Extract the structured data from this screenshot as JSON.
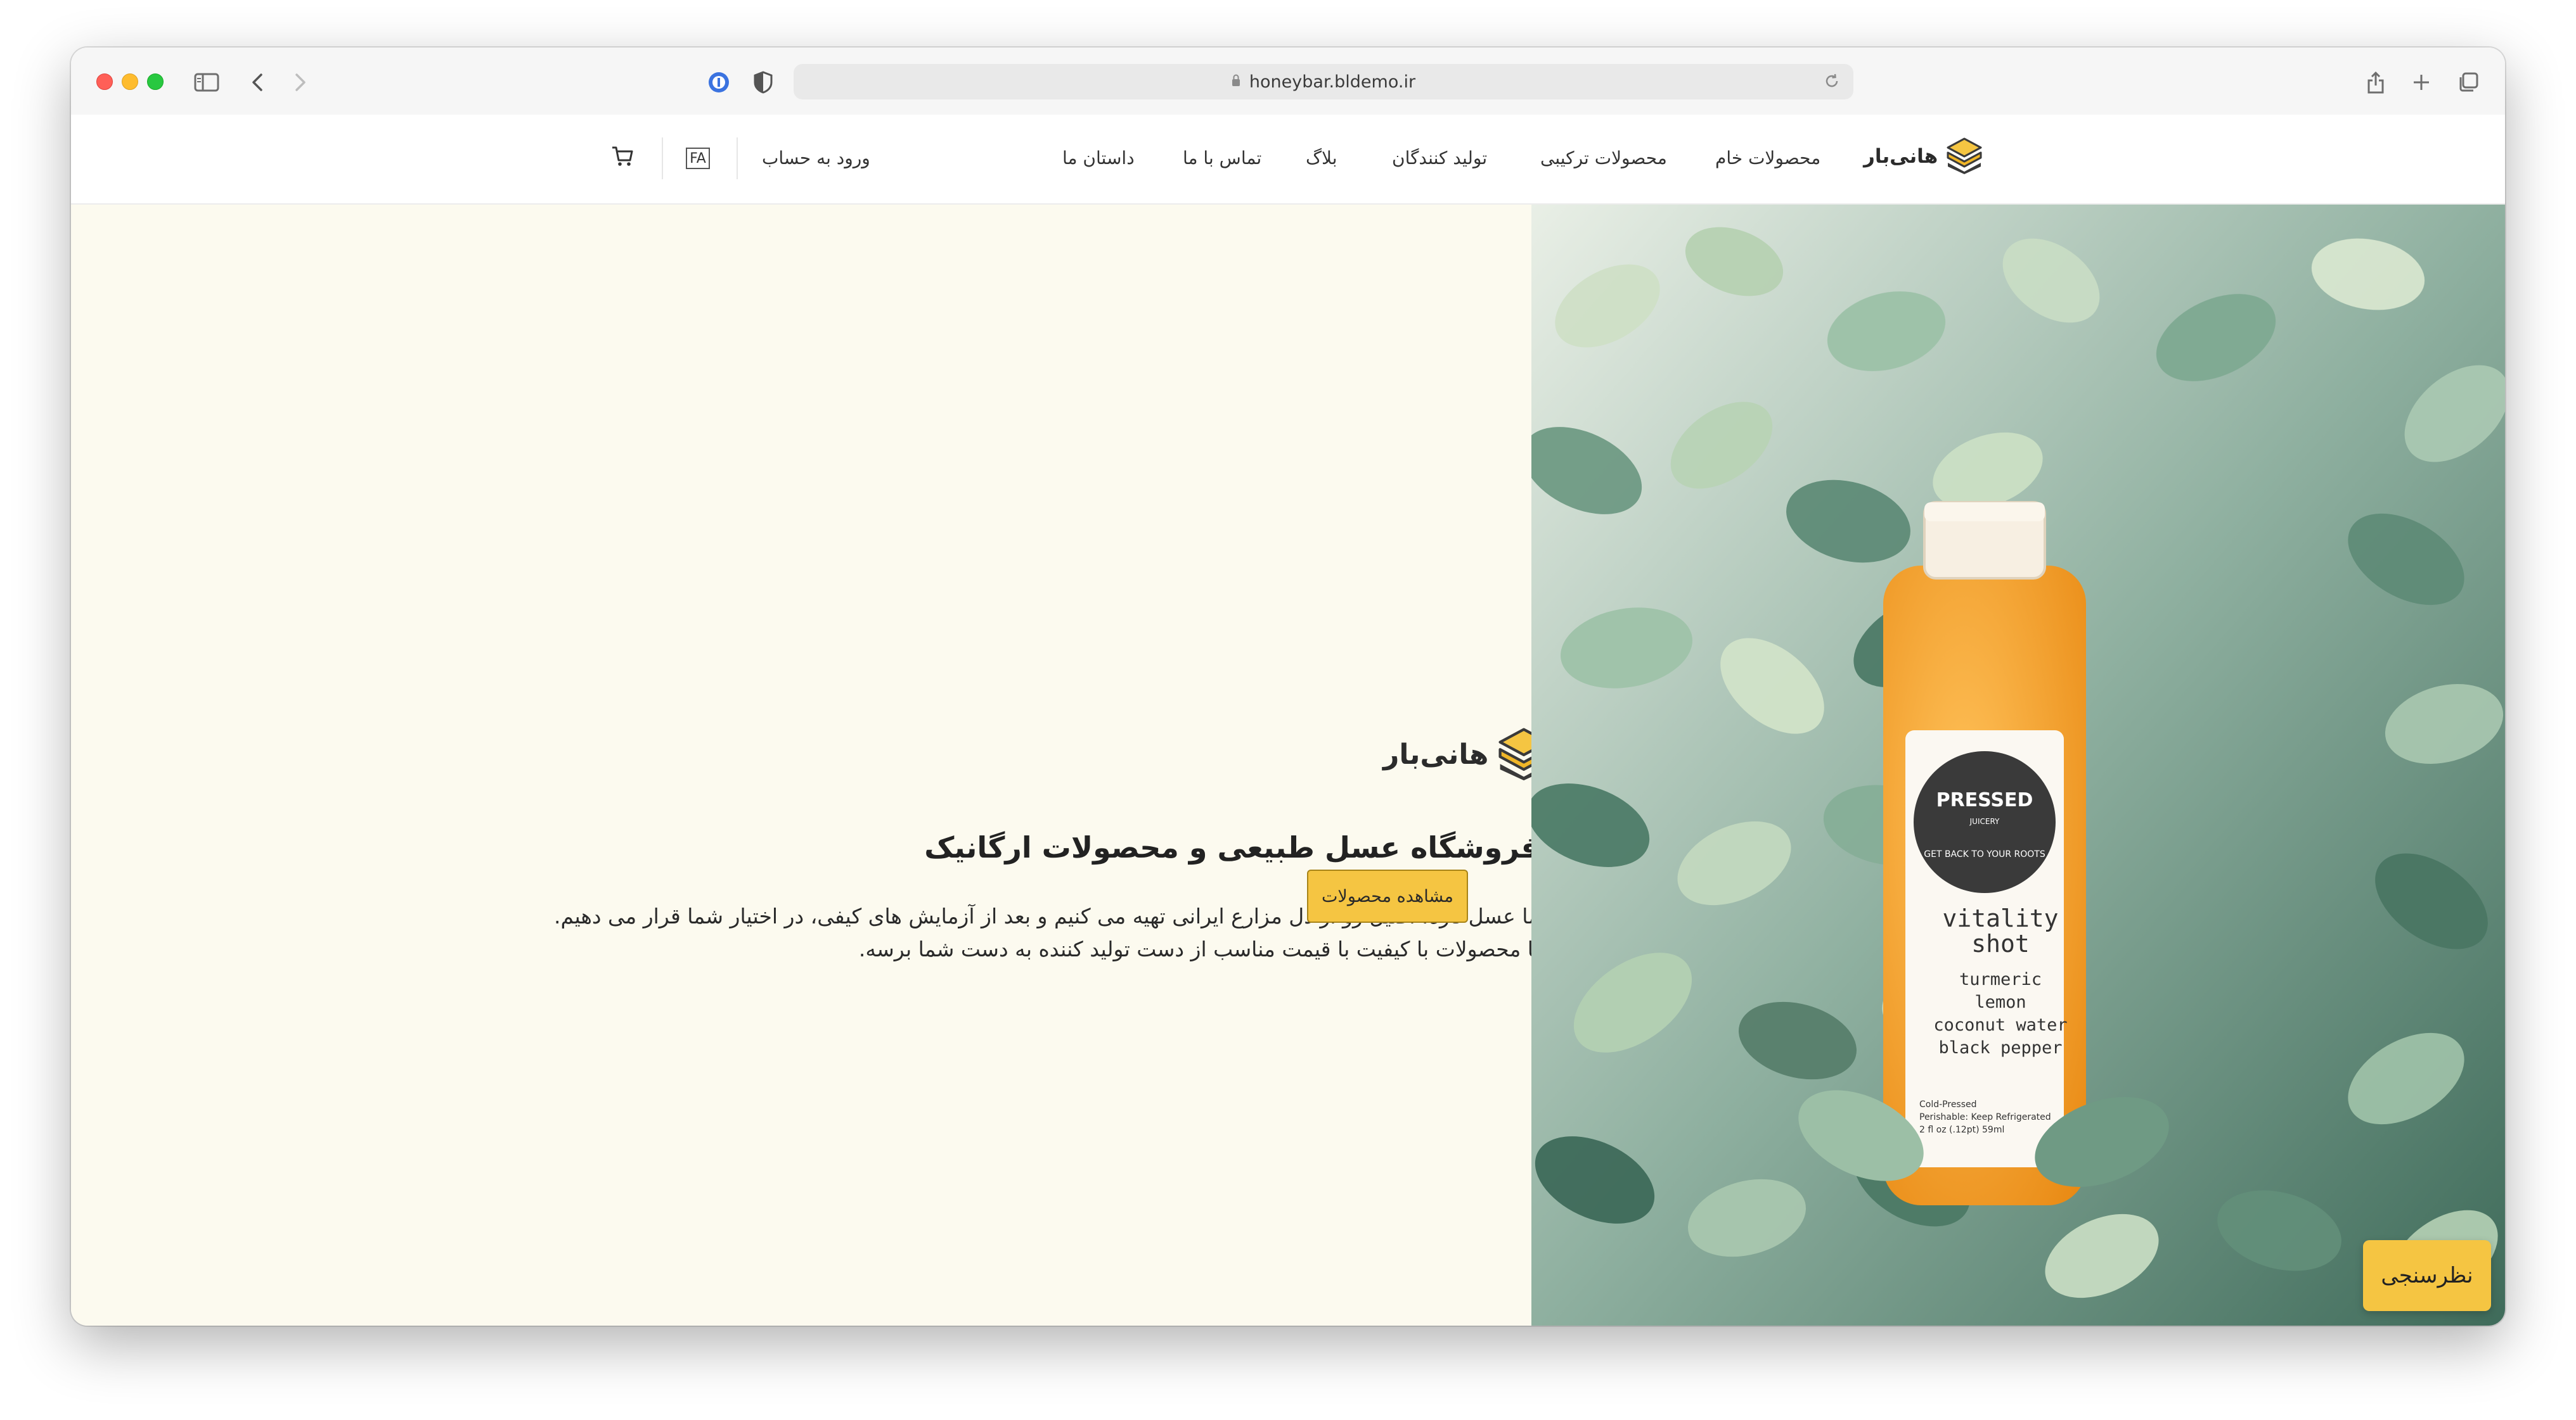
{
  "browser": {
    "url": "honeybar.bldemo.ir"
  },
  "header": {
    "logo_text": "هانی‌بار",
    "nav": [
      {
        "label": "محصولات خام"
      },
      {
        "label": "محصولات ترکیبی"
      },
      {
        "label": "تولید کنندگان"
      },
      {
        "label": "بلاگ"
      },
      {
        "label": "تماس با ما"
      },
      {
        "label": "داستان ما"
      }
    ],
    "login_label": "ورود به حساب",
    "lang_label": "FA"
  },
  "hero": {
    "logo_text": "هانی‌بار",
    "title": "فروشگاه عسل طبیعی و محصولات ارگانیک",
    "description_lines": [
      "ما عسل تازه، اصیل رو از دل مزارع ایرانی تهیه می کنیم و بعد از آزمایش های کیفی، در اختیار شما قرار می دهیم.",
      "تا محصولات با کیفیت با قیمت مناسب از دست تولید کننده به دست شما برسه."
    ],
    "cta_label": "مشاهده محصولات"
  },
  "product_image": {
    "brand_lines": [
      "PRESSED",
      "JUICERY"
    ],
    "slogan": "GET BACK TO YOUR ROOTS",
    "name_lines": [
      "vitality",
      "shot"
    ],
    "ingredients": [
      "turmeric",
      "lemon",
      "coconut water",
      "black pepper"
    ],
    "footnote_lines": [
      "Cold-Pressed",
      "Perishable: Keep Refrigerated",
      "2 fl oz (.12pt) 59ml"
    ]
  },
  "survey_label": "نظرسنجی",
  "colors": {
    "accent": "#f5c542",
    "hero_bg": "#fcfaef",
    "juice": "#f39a1e"
  }
}
